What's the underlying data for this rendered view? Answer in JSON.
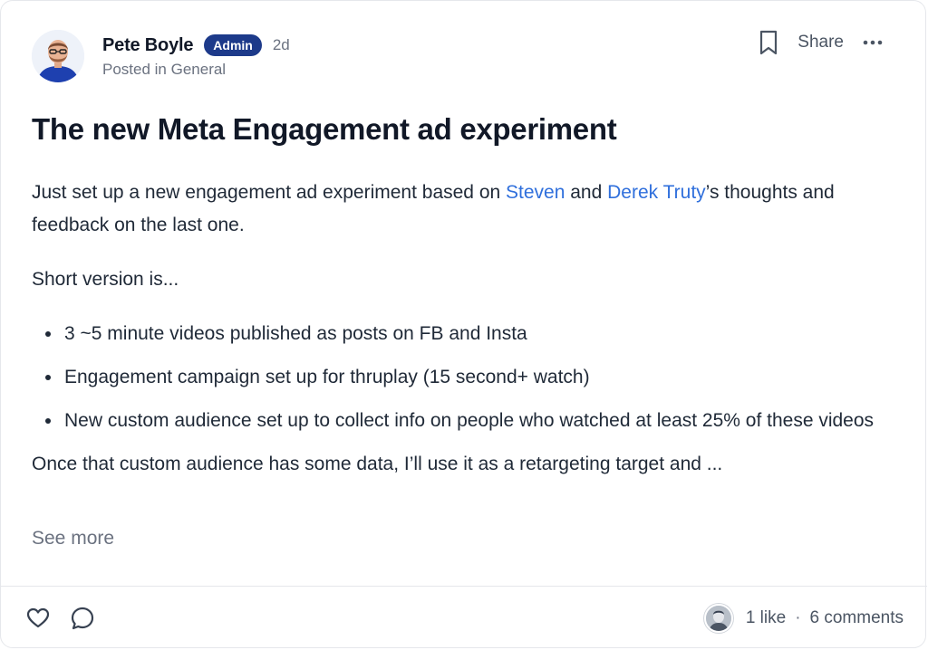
{
  "post": {
    "author": {
      "name": "Pete Boyle",
      "badge": "Admin",
      "time": "2d",
      "posted_in": "Posted in General"
    },
    "actions": {
      "bookmark_icon": "bookmark-icon",
      "share_label": "Share",
      "more_icon": "more-horizontal-icon"
    },
    "title": "The new Meta Engagement ad experiment",
    "paragraph1": {
      "prefix": "Just set up a new engagement ad experiment based on ",
      "mention1": "Steven",
      "middle": " and ",
      "mention2": "Derek Truty",
      "suffix": "’s thoughts and feedback on the last one."
    },
    "paragraph2": "Short version is...",
    "bullets": [
      "3 ~5 minute videos published as posts on FB and Insta",
      "Engagement campaign set up for thruplay (15 second+ watch)",
      "New custom audience set up to collect info on people who watched at least 25% of these videos"
    ],
    "paragraph3": "Once that custom audience has some data, I’ll use it as a retargeting target and ...",
    "see_more": "See more",
    "footer": {
      "like_icon": "heart-icon",
      "comment_icon": "comment-icon",
      "likes": "1 like",
      "separator": "·",
      "comments": "6 comments"
    },
    "colors": {
      "accent": "#2f6fdc",
      "badge_bg": "#1d3a8a",
      "muted": "#6b7280"
    }
  }
}
